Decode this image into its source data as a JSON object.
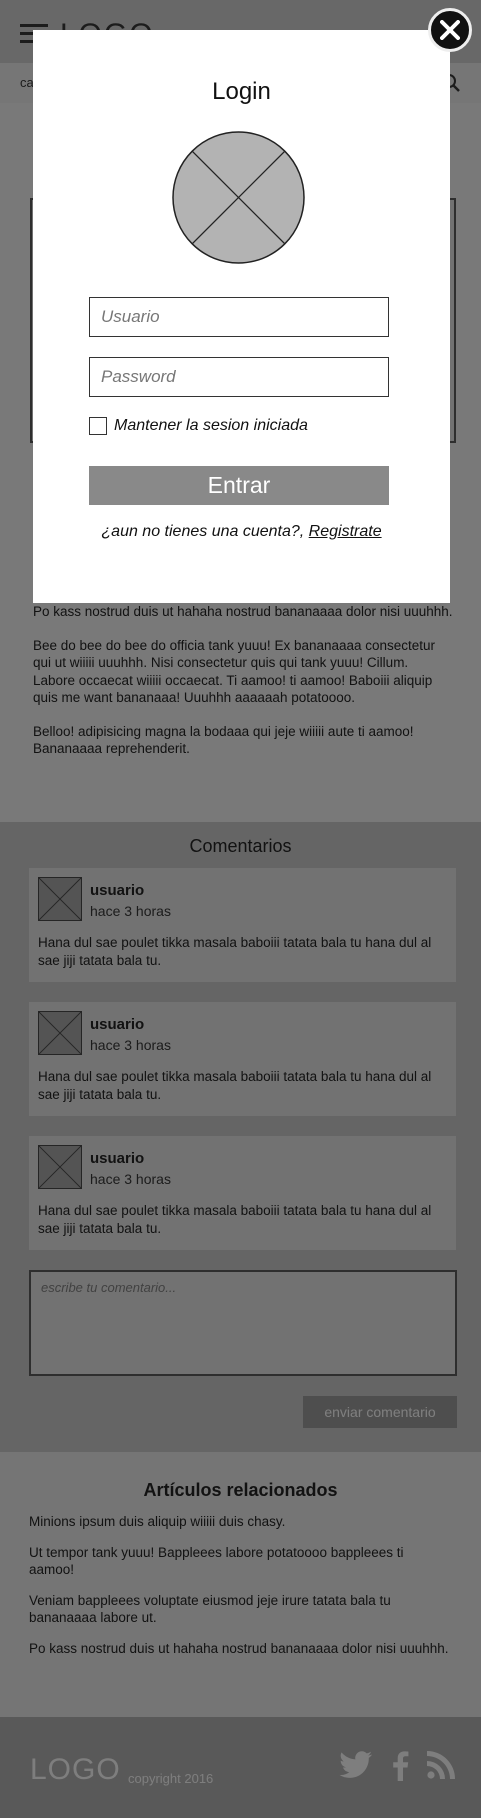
{
  "header": {
    "logo": "LOGO",
    "nav_label": "ca"
  },
  "article": {
    "paragraphs": [
      "Po kass nostrud duis ut hahaha nostrud bananaaaa dolor nisi uuuhhh.",
      "Bee do bee do bee do officia tank yuuu! Ex bananaaaa consectetur qui ut wiiiii uuuhhh. Nisi consectetur quis qui tank yuuu! Cillum. Labore occaecat wiiiii occaecat. Ti aamoo! ti aamoo! Baboiii aliquip quis me want bananaaa! Uuuhhh aaaaaah potatoooo.",
      "Belloo! adipisicing magna la bodaaa qui jeje wiiiii aute ti aamoo! Bananaaaa reprehenderit."
    ]
  },
  "comments": {
    "title": "Comentarios",
    "items": [
      {
        "user": "usuario",
        "time": "hace 3 horas",
        "text": "Hana dul sae poulet tikka masala baboiii tatata bala tu hana dul al sae jiji tatata bala tu."
      },
      {
        "user": "usuario",
        "time": "hace 3 horas",
        "text": "Hana dul sae poulet tikka masala baboiii tatata bala tu hana dul al sae jiji tatata bala tu."
      },
      {
        "user": "usuario",
        "time": "hace 3 horas",
        "text": "Hana dul sae poulet tikka masala baboiii tatata bala tu hana dul al sae jiji tatata bala tu."
      }
    ],
    "input_placeholder": "escribe tu comentario...",
    "send_label": "enviar comentario"
  },
  "related": {
    "title": "Artículos relacionados",
    "items": [
      "Minions ipsum duis aliquip wiiiii duis chasy.",
      "Ut tempor tank yuuu! Bappleees labore potatoooo bappleees ti aamoo!",
      "Veniam bappleees voluptate eiusmod jeje irure tatata bala tu bananaaaa labore ut.",
      "Po kass nostrud duis ut hahaha nostrud bananaaaa dolor nisi uuuhhh."
    ]
  },
  "footer": {
    "logo": "LOGO",
    "copyright": "copyright 2016",
    "social_icons": [
      "twitter-icon",
      "facebook-icon",
      "rss-icon"
    ]
  },
  "modal": {
    "title": "Login",
    "username_placeholder": "Usuario",
    "password_placeholder": "Password",
    "remember_label": "Mantener la sesion iniciada",
    "submit_label": "Entrar",
    "signup_prompt": "¿aun no tienes una cuenta?,",
    "signup_link": "Registrate",
    "close_icon": "close-icon"
  }
}
